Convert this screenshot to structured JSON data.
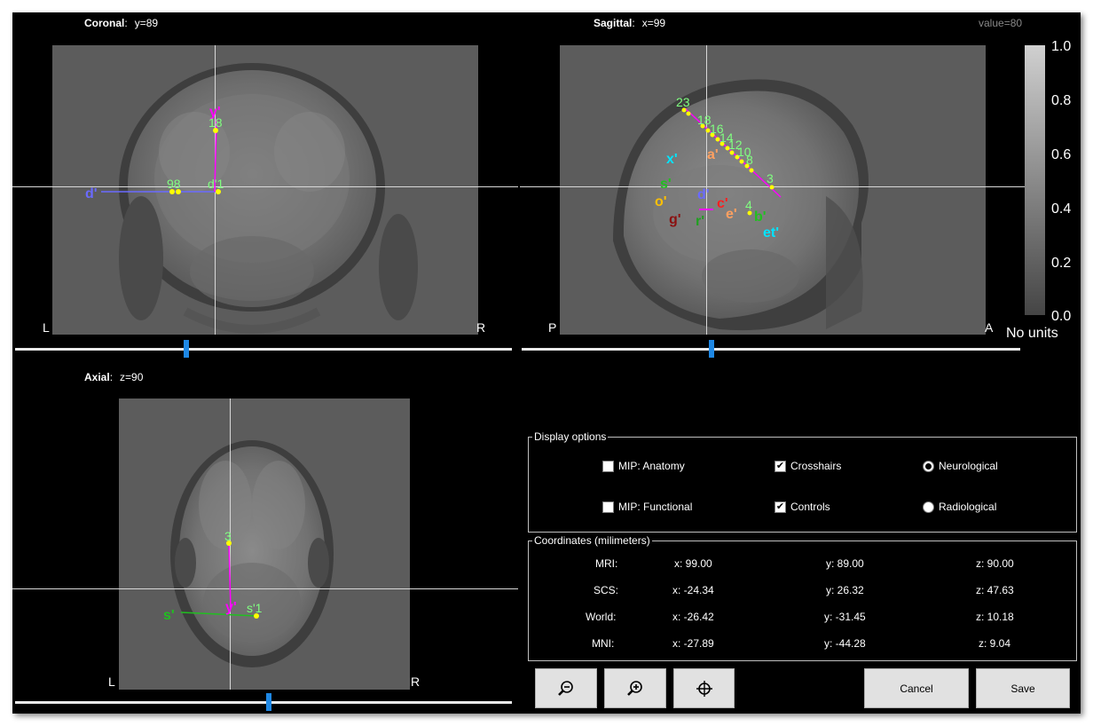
{
  "views": {
    "coronal": {
      "label": "Coronal",
      "coord": "y=89",
      "left": "L",
      "right": "R",
      "slider_fraction": 0.345
    },
    "sagittal": {
      "label": "Sagittal",
      "coord": "x=99",
      "left": "P",
      "right": "A",
      "slider_fraction": 0.38
    },
    "axial": {
      "label": "Axial",
      "coord": "z=90",
      "left": "L",
      "right": "R",
      "slider_fraction": 0.51
    }
  },
  "value_readout": "value=80",
  "colorbar": {
    "ticks": [
      "1.0",
      "0.8",
      "0.6",
      "0.4",
      "0.2",
      "0.0"
    ],
    "units": "No units"
  },
  "markers": {
    "coronal": [
      "d'",
      "y'",
      "18",
      "98",
      "d'1"
    ],
    "sagittal": [
      "23",
      "x'",
      "s'",
      "o'",
      "g'",
      "r'",
      "d'",
      "c'",
      "e'",
      "4",
      "b'",
      "et'",
      "a'",
      "3",
      "18",
      "16",
      "14",
      "12",
      "10",
      "8"
    ],
    "axial": [
      "3",
      "s'",
      "y'",
      "s'1"
    ]
  },
  "display_options": {
    "legend": "Display options",
    "mip_anatomy": {
      "label": "MIP: Anatomy",
      "checked": false
    },
    "mip_functional": {
      "label": "MIP: Functional",
      "checked": false
    },
    "crosshairs": {
      "label": "Crosshairs",
      "checked": true
    },
    "controls": {
      "label": "Controls",
      "checked": true
    },
    "neurological": {
      "label": "Neurological",
      "selected": true
    },
    "radiological": {
      "label": "Radiological",
      "selected": false
    }
  },
  "coordinates": {
    "legend": "Coordinates (milimeters)",
    "rows": [
      {
        "name": "MRI:",
        "x": "x: 99.00",
        "y": "y: 89.00",
        "z": "z: 90.00"
      },
      {
        "name": "SCS:",
        "x": "x: -24.34",
        "y": "y: 26.32",
        "z": "z: 47.63"
      },
      {
        "name": "World:",
        "x": "x: -26.42",
        "y": "y: -31.45",
        "z": "z: 10.18"
      },
      {
        "name": "MNI:",
        "x": "x: -27.89",
        "y": "y: -44.28",
        "z": "z: 9.04"
      }
    ]
  },
  "buttons": {
    "zoom_out_icon": "zoom-out-icon",
    "zoom_in_icon": "zoom-in-icon",
    "center_icon": "crosshair-target-icon",
    "cancel": "Cancel",
    "save": "Save"
  },
  "colors": {
    "background": "#000000",
    "slider_thumb": "#1e88e5",
    "contact": "#ffff00",
    "contact_label": "#80ff80",
    "electrode_magenta": "#ff00ff",
    "electrode_blue": "#6a6aff",
    "electrode_cyan": "#00e5ff",
    "electrode_green": "#20c020",
    "electrode_orange": "#ffa060",
    "electrode_red": "#ff2020"
  }
}
